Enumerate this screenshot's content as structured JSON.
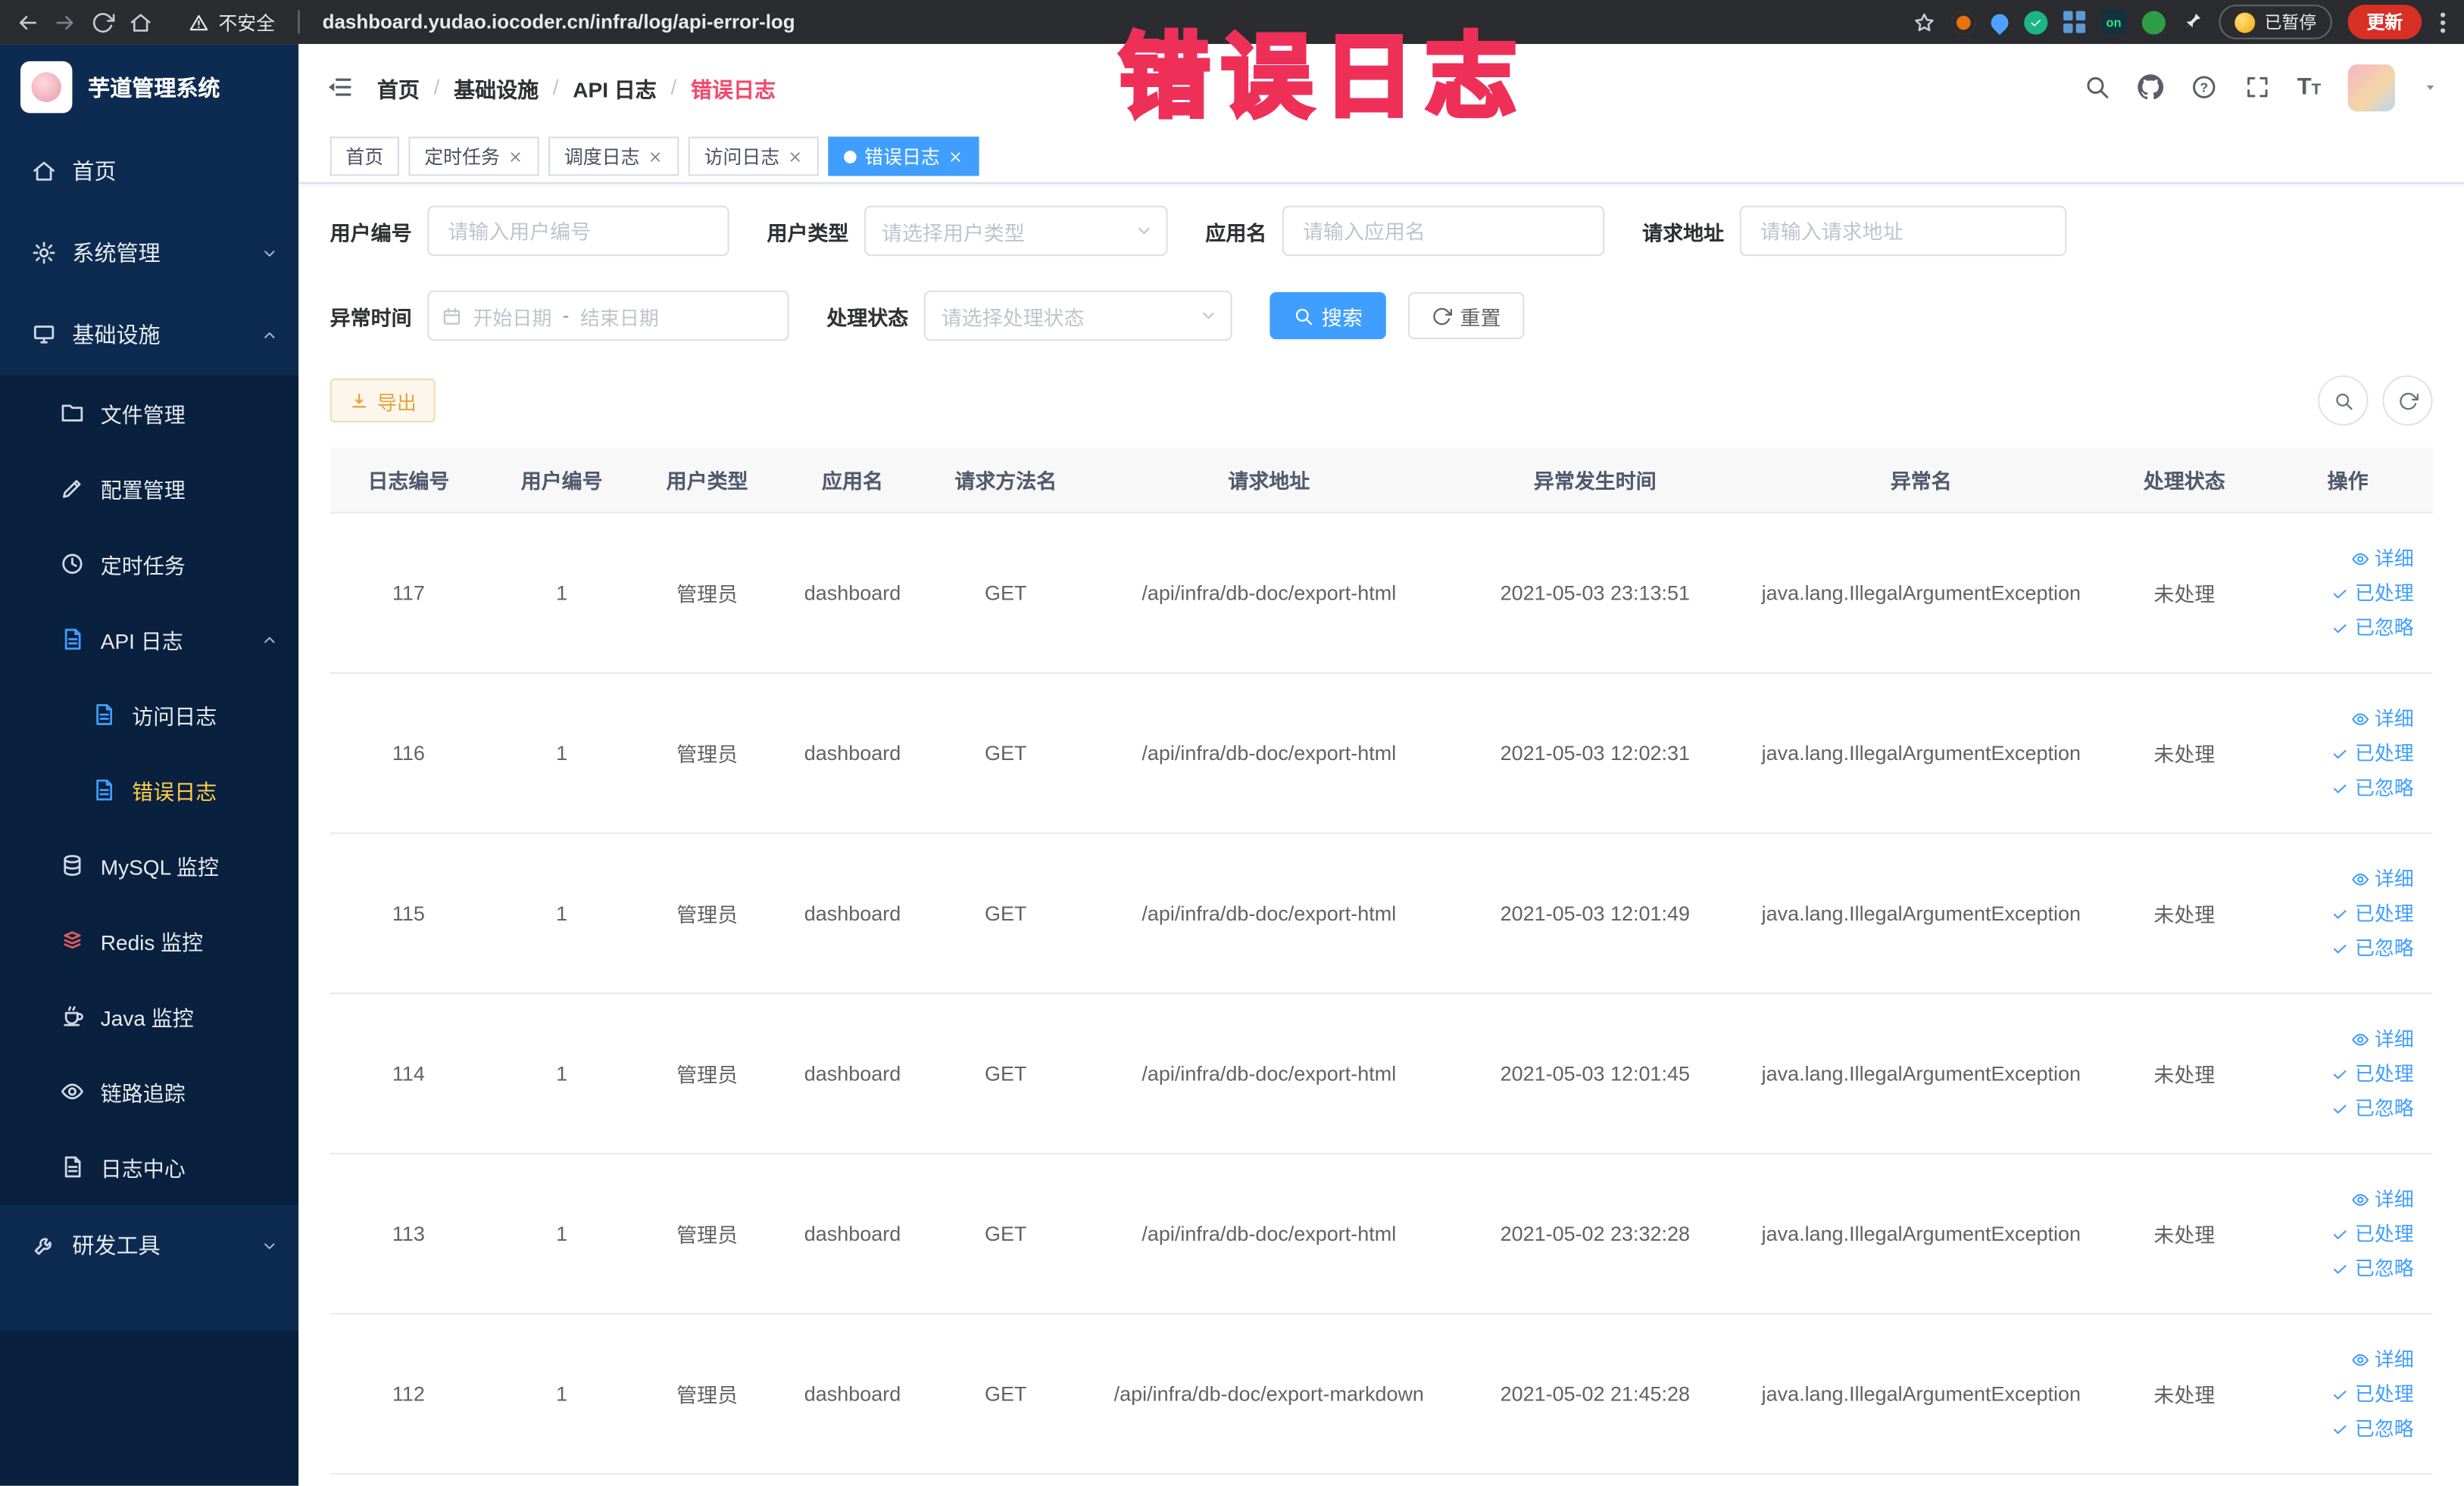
{
  "browser": {
    "security_label": "不安全",
    "url": "dashboard.yudao.iocoder.cn/infra/log/api-error-log",
    "paused_label": "已暂停",
    "update_label": "更新",
    "extension_on_label": "on"
  },
  "annotation": {
    "text": "错误日志"
  },
  "sidebar": {
    "title": "芋道管理系统",
    "items": [
      {
        "label": "首页"
      },
      {
        "label": "系统管理"
      },
      {
        "label": "基础设施"
      },
      {
        "label": "文件管理"
      },
      {
        "label": "配置管理"
      },
      {
        "label": "定时任务"
      },
      {
        "label": "API 日志"
      },
      {
        "label": "访问日志"
      },
      {
        "label": "错误日志",
        "active": true
      },
      {
        "label": "MySQL 监控"
      },
      {
        "label": "Redis 监控"
      },
      {
        "label": "Java 监控"
      },
      {
        "label": "链路追踪"
      },
      {
        "label": "日志中心"
      },
      {
        "label": "研发工具"
      }
    ]
  },
  "header": {
    "breadcrumb": [
      {
        "label": "首页"
      },
      {
        "label": "基础设施"
      },
      {
        "label": "API 日志"
      },
      {
        "label": "错误日志"
      }
    ]
  },
  "tabs": [
    {
      "label": "首页"
    },
    {
      "label": "定时任务"
    },
    {
      "label": "调度日志"
    },
    {
      "label": "访问日志"
    },
    {
      "label": "错误日志"
    }
  ],
  "filters": {
    "user_id": {
      "label": "用户编号",
      "placeholder": "请输入用户编号"
    },
    "user_type": {
      "label": "用户类型",
      "placeholder": "请选择用户类型"
    },
    "app_name": {
      "label": "应用名",
      "placeholder": "请输入应用名"
    },
    "request_url": {
      "label": "请求地址",
      "placeholder": "请输入请求地址"
    },
    "exception_time": {
      "label": "异常时间",
      "start_placeholder": "开始日期",
      "separator": "-",
      "end_placeholder": "结束日期"
    },
    "process_status": {
      "label": "处理状态",
      "placeholder": "请选择处理状态"
    },
    "search_label": "搜索",
    "reset_label": "重置"
  },
  "toolbar": {
    "export_label": "导出"
  },
  "table": {
    "columns": [
      "日志编号",
      "用户编号",
      "用户类型",
      "应用名",
      "请求方法名",
      "请求地址",
      "异常发生时间",
      "异常名",
      "处理状态",
      "操作"
    ],
    "actions": {
      "detail": "详细",
      "processed": "已处理",
      "ignored": "已忽略"
    },
    "rows": [
      {
        "id": "117",
        "user_id": "1",
        "user_type": "管理员",
        "app": "dashboard",
        "method": "GET",
        "url": "/api/infra/db-doc/export-html",
        "time": "2021-05-03 23:13:51",
        "exception": "java.lang.IllegalArgumentException",
        "status": "未处理"
      },
      {
        "id": "116",
        "user_id": "1",
        "user_type": "管理员",
        "app": "dashboard",
        "method": "GET",
        "url": "/api/infra/db-doc/export-html",
        "time": "2021-05-03 12:02:31",
        "exception": "java.lang.IllegalArgumentException",
        "status": "未处理"
      },
      {
        "id": "115",
        "user_id": "1",
        "user_type": "管理员",
        "app": "dashboard",
        "method": "GET",
        "url": "/api/infra/db-doc/export-html",
        "time": "2021-05-03 12:01:49",
        "exception": "java.lang.IllegalArgumentException",
        "status": "未处理"
      },
      {
        "id": "114",
        "user_id": "1",
        "user_type": "管理员",
        "app": "dashboard",
        "method": "GET",
        "url": "/api/infra/db-doc/export-html",
        "time": "2021-05-03 12:01:45",
        "exception": "java.lang.IllegalArgumentException",
        "status": "未处理"
      },
      {
        "id": "113",
        "user_id": "1",
        "user_type": "管理员",
        "app": "dashboard",
        "method": "GET",
        "url": "/api/infra/db-doc/export-html",
        "time": "2021-05-02 23:32:28",
        "exception": "java.lang.IllegalArgumentException",
        "status": "未处理"
      },
      {
        "id": "112",
        "user_id": "1",
        "user_type": "管理员",
        "app": "dashboard",
        "method": "GET",
        "url": "/api/infra/db-doc/export-markdown",
        "time": "2021-05-02 21:45:28",
        "exception": "java.lang.IllegalArgumentException",
        "status": "未处理"
      }
    ]
  },
  "colors": {
    "primary": "#409eff",
    "menu_active": "#ffd04b",
    "warning": "#e6a23c",
    "annotation": "#ee3059"
  }
}
